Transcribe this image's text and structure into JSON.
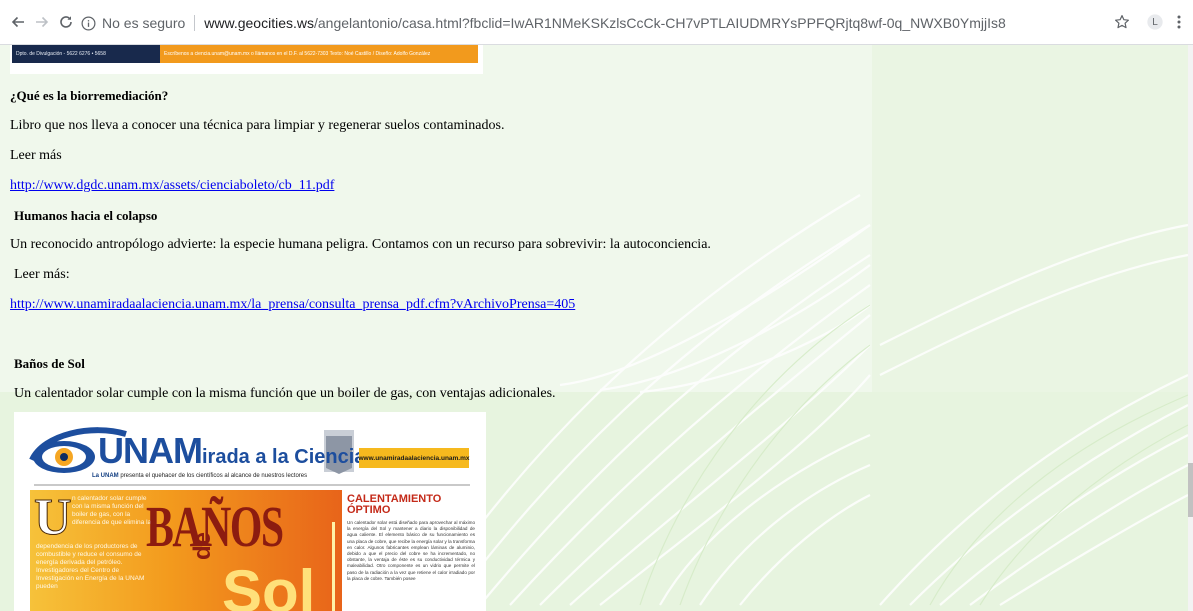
{
  "browser": {
    "security_label": "No es seguro",
    "url_host": "www.geocities.ws",
    "url_path": "/angelantonio/casa.html?fbclid=IwAR1NMeKSKzlsCcCk-CH7vPTLAIUDMRYsPPFQRjtq8wf-0q_NWXB0YmjjIs8",
    "profile_initial": "L"
  },
  "page": {
    "top_banner": {
      "strip_left": "Dpto. de Divulgación - 5622 6276 • 5658",
      "strip_right": "Escríbenos a ciencia.unam@unam.mx o llámanos en el D.F. al 5622-7303      Texto: Noé Castillo / Diseño: Adolfo González"
    },
    "articles": [
      {
        "title": "¿Qué es la biorremediación?",
        "description": "Libro que nos lleva a conocer una técnica para limpiar y regenerar suelos contaminados.",
        "read_more": "Leer más",
        "link": "http://www.dgdc.unam.mx/assets/cienciaboleto/cb_11.pdf"
      },
      {
        "title": "Humanos hacia el colapso",
        "description": "Un reconocido antropólogo advierte: la especie humana peligra. Contamos con un recurso para sobrevivir: la autoconciencia.",
        "read_more": "Leer más:",
        "link": "http://www.unamiradaalaciencia.unam.mx/la_prensa/consulta_prensa_pdf.cfm?vArchivoPrensa=405"
      },
      {
        "title": "Baños de Sol",
        "description": "Un calentador solar cumple con la misma función que un boiler de gas, con ventajas adicionales."
      }
    ],
    "article_image": {
      "brand_unam": "UNAM",
      "brand_rest": "irada a la Ciencia",
      "tagline_bold": "La UNAM",
      "tagline_rest": "presenta el quehacer de los científicos al alcance de nuestros lectores",
      "site": "www.unamiradaalaciencia.unam.mx",
      "big_letter": "U",
      "intro_top": "n calentador solar cumple con la misma función del boiler de gas, con la diferencia de que elimina la",
      "intro_bottom": "dependencia de los productores de combustible y reduce el consumo de energía derivada del petróleo. Investigadores del Centro de Investigación en Energía de la UNAM pueden",
      "headline": "BAÑOS",
      "headline_de": "de",
      "headline_sol": "Sol",
      "side_title": "CALENTAMIENTO ÓPTIMO",
      "side_body": "Un calentador solar está diseñado para aprovechar al máximo la energía del Sol y mantener a diario la disponibilidad de agua caliente. El elemento básico de su funcionamiento es una placa de cobre, que recibe la energía solar y la transforma en calor. Algunos fabricantes emplean láminas de aluminio, debido a que el precio del cobre se ha incrementado, no obstante, la ventaja de éste es su conductividad térmica y maleabilidad. Otro componente es un vidrio que permite el paso de la radiación a la vez que retiene el calor irradiado por la placa de cobre. También posee"
    }
  },
  "colors": {
    "link": "#0000ee",
    "unam_blue": "#1d4e9e",
    "orange": "#f39a1d",
    "page_green": "#eef7e8"
  }
}
